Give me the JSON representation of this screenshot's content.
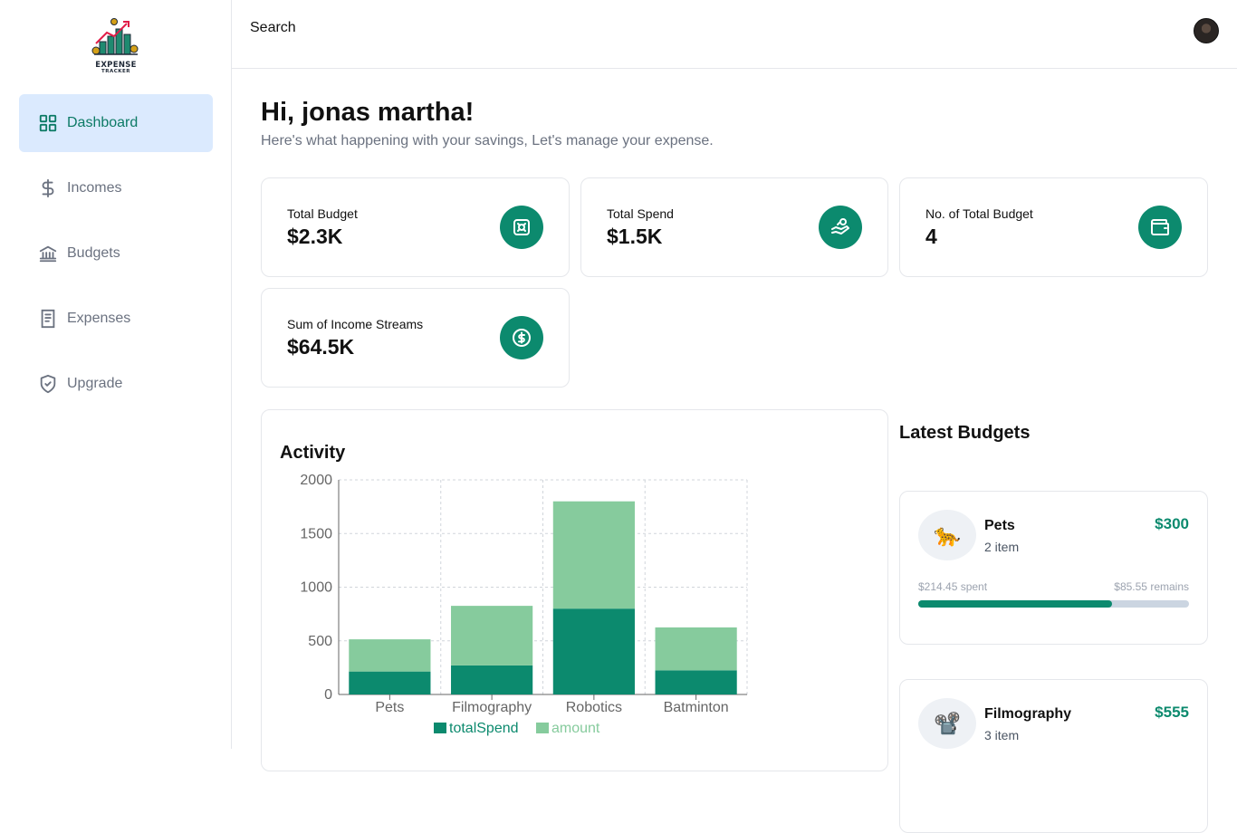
{
  "logo": {
    "line1": "EXPENSE",
    "line2": "TRACKER"
  },
  "sidebar": {
    "items": [
      {
        "label": "Dashboard",
        "icon": "dashboard-grid-icon",
        "active": true
      },
      {
        "label": "Incomes",
        "icon": "dollar-icon",
        "active": false
      },
      {
        "label": "Budgets",
        "icon": "bank-icon",
        "active": false
      },
      {
        "label": "Expenses",
        "icon": "receipt-icon",
        "active": false
      },
      {
        "label": "Upgrade",
        "icon": "shield-check-icon",
        "active": false
      }
    ]
  },
  "header": {
    "search_label": "Search",
    "avatar": "user-avatar"
  },
  "main": {
    "greeting": "Hi, jonas martha!",
    "subtitle": "Here's what happening with your savings, Let's manage your expense."
  },
  "stats": [
    {
      "label": "Total Budget",
      "value": "$2.3K",
      "icon": "piggy-bank-icon"
    },
    {
      "label": "Total Spend",
      "value": "$1.5K",
      "icon": "hand-coins-icon"
    },
    {
      "label": "No. of Total Budget",
      "value": "4",
      "icon": "wallet-icon"
    },
    {
      "label": "Sum of Income Streams",
      "value": "$64.5K",
      "icon": "circle-dollar-icon"
    }
  ],
  "colors": {
    "accent": "#0c8a6e",
    "accent_light": "#86cb9d",
    "active_nav_bg": "#dbeafe"
  },
  "chart_data": {
    "type": "bar",
    "stacked": true,
    "title": "Activity",
    "categories": [
      "Pets",
      "Filmography",
      "Robotics",
      "Batminton"
    ],
    "series": [
      {
        "name": "totalSpend",
        "values": [
          214,
          271,
          800,
          225
        ],
        "color": "#0c8a6e"
      },
      {
        "name": "amount",
        "values": [
          300,
          555,
          1000,
          400
        ],
        "color": "#86cb9d"
      }
    ],
    "yticks": [
      "0",
      "500",
      "1000",
      "1500",
      "2000"
    ],
    "ylim": [
      0,
      2000
    ],
    "grid": true,
    "legend": "bottom"
  },
  "latest": {
    "title": "Latest Budgets",
    "budgets": [
      {
        "emoji": "🐆",
        "name": "Pets",
        "items": "2 item",
        "amount": "$300",
        "spent": "$214.45 spent",
        "remains": "$85.55 remains",
        "progress": 0.715
      },
      {
        "emoji": "📽️",
        "name": "Filmography",
        "items": "3 item",
        "amount": "$555"
      }
    ]
  }
}
